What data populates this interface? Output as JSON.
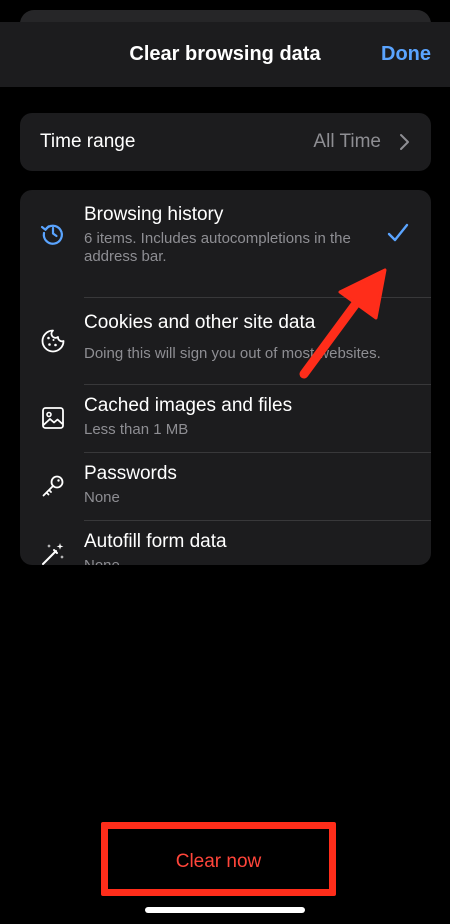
{
  "header": {
    "title": "Clear browsing data",
    "done_label": "Done"
  },
  "time_range": {
    "label": "Time range",
    "value": "All Time"
  },
  "options": [
    {
      "icon": "history-icon",
      "title": "Browsing history",
      "subtitle": "6 items. Includes autocompletions in the address bar.",
      "checked": true
    },
    {
      "icon": "cookie-icon",
      "title": "Cookies and other site data",
      "subtitle": "Doing this will sign you out of most websites.",
      "checked": false
    },
    {
      "icon": "image-icon",
      "title": "Cached images and files",
      "subtitle": "Less than 1 MB",
      "checked": false
    },
    {
      "icon": "key-icon",
      "title": "Passwords",
      "subtitle": "None",
      "checked": false
    },
    {
      "icon": "magic-wand-icon",
      "title": "Autofill form data",
      "subtitle": "None",
      "checked": false
    }
  ],
  "clear_button": {
    "label": "Clear now"
  },
  "colors": {
    "accent": "#5aa4ff",
    "danger": "#ff453a",
    "annotation": "#ff2d1a"
  }
}
